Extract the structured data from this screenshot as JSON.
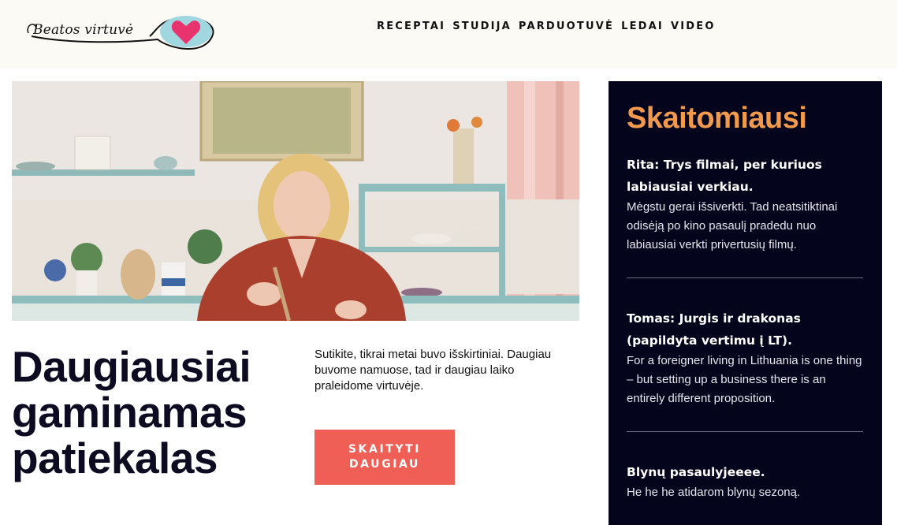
{
  "logo": {
    "text": "Beatos virtuvė",
    "icon": "heart-spoon-icon"
  },
  "nav": {
    "items": [
      {
        "label": "RECEPTAI"
      },
      {
        "label": "STUDIJA"
      },
      {
        "label": "PARDUOTUVĖ"
      },
      {
        "label": "LEDAI"
      },
      {
        "label": "VIDEO"
      }
    ]
  },
  "hero": {
    "headline": "Daugiausiai gaminamas patiekalas",
    "teaser": "Sutikite, tikrai metai buvo išskirtiniai. Daugiau buvome namuose, tad ir daugiau laiko praleidome virtuvėje.",
    "cta": "SKAITYTI DAUGIAU"
  },
  "sidebar": {
    "title": "Skaitomiausi",
    "items": [
      {
        "title": "Rita: Trys filmai, per kuriuos labiausiai verkiau.",
        "desc": "Mėgstu gerai išsiverkti. Tad neatsitiktinai odisėją po kino pasaulį pradedu nuo labiausiai verkti privertusių filmų."
      },
      {
        "title": "Tomas: Jurgis ir drakonas (papildyta vertimu į LT).",
        "desc": "For a foreigner living in Lithuania is one thing – but setting up a business there is an entirely different proposition."
      },
      {
        "title": "Blynų pasaulyjeeee.",
        "desc": "He he he atidarom blynų sezoną."
      }
    ]
  },
  "colors": {
    "accent_orange": "#f19a4d",
    "cta_red": "#ef5f55",
    "sidebar_bg": "#04041c",
    "header_bg": "#fcfaf4",
    "heart_pink": "#e8336f",
    "spoon_blue": "#9fd6e0"
  }
}
